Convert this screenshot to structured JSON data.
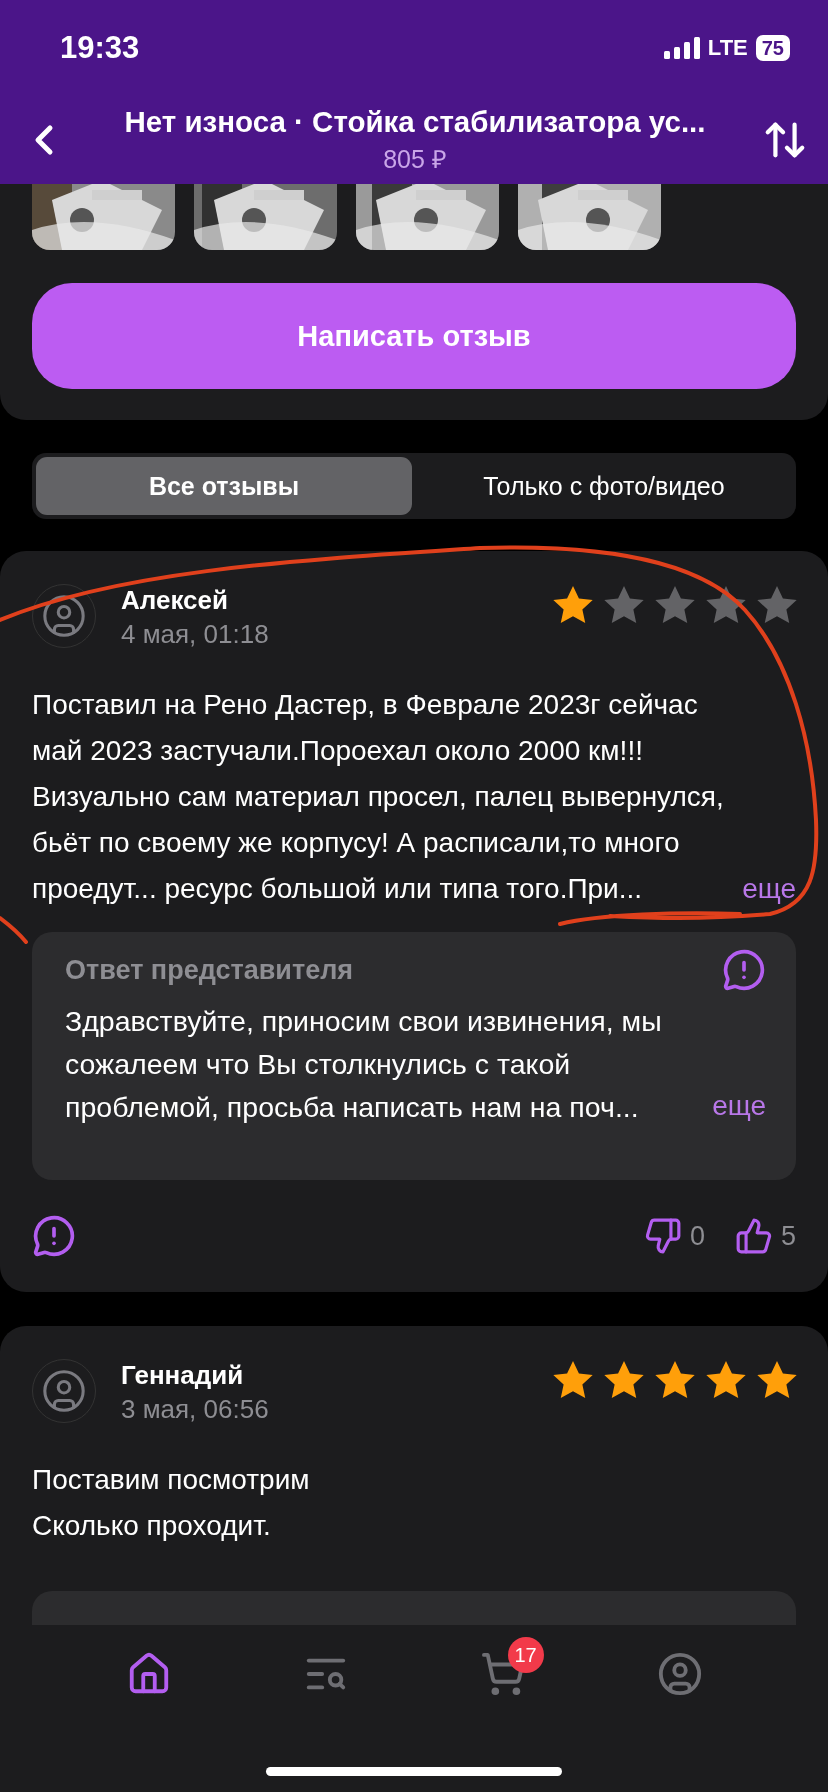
{
  "status_bar": {
    "time": "19:33",
    "network": "LTE",
    "battery": "75"
  },
  "header": {
    "title": "Нет износа · Стойка стабилизатора ус...",
    "price": "805 ₽"
  },
  "write_review_button": "Написать отзыв",
  "filter_tabs": [
    {
      "label": "Все отзывы",
      "selected": true
    },
    {
      "label": "Только с фото/видео",
      "selected": false
    }
  ],
  "reviews": [
    {
      "author": "Алексей",
      "date": "4 мая, 01:18",
      "stars": 1,
      "text": "Поставил на Рено Дастер, в Феврале 2023г сейчас\nмай 2023 застучали.Пороехал около 2000 км!!!\nВизуально сам материал просел, палец вывернулся,\nбьёт по своему же корпусу! А расписали,то много\nпроедут... ресурс большой или типа того.При...",
      "more": "еще",
      "reply": {
        "title": "Ответ представителя",
        "text": "Здравствуйте, приносим свои извинения, мы\nсожалеем что Вы столкнулись с такой\nпроблемой, просьба написать нам на поч...",
        "more": "еще"
      },
      "dislikes": "0",
      "likes": "5"
    },
    {
      "author": "Геннадий",
      "date": "3 мая, 06:56",
      "stars": 5,
      "text": "Поставим посмотрим\nСколько проходит."
    }
  ],
  "bottom_nav": [
    {
      "kind": "home",
      "selected": true
    },
    {
      "kind": "catalog",
      "selected": false
    },
    {
      "kind": "cart",
      "selected": false,
      "badge": "17"
    },
    {
      "kind": "profile",
      "selected": false
    }
  ]
}
